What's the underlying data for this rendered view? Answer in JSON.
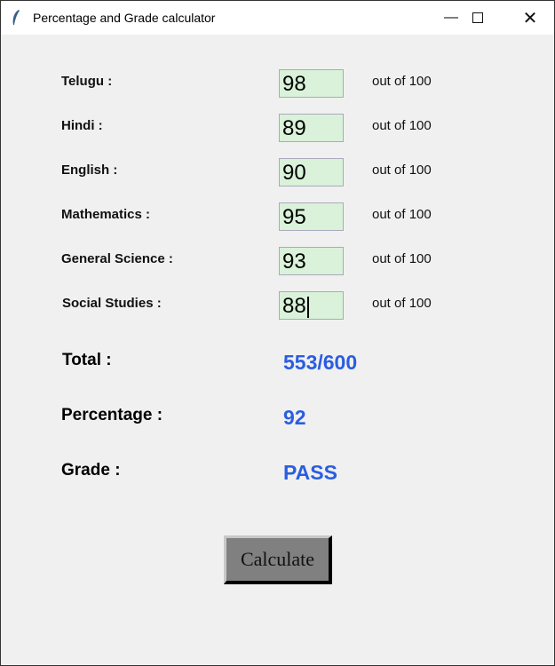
{
  "window": {
    "title": "Percentage and Grade calculator"
  },
  "subjects": [
    {
      "label": "Telugu :",
      "value": "98",
      "suffix": "out of 100"
    },
    {
      "label": "Hindi :",
      "value": "89",
      "suffix": "out of 100"
    },
    {
      "label": "English :",
      "value": "90",
      "suffix": "out of 100"
    },
    {
      "label": "Mathematics :",
      "value": "95",
      "suffix": "out of 100"
    },
    {
      "label": "General Science :",
      "value": "93",
      "suffix": "out of 100"
    },
    {
      "label": "Social Studies :",
      "value": "88",
      "suffix": "out of 100"
    }
  ],
  "results": {
    "total_label": "Total :",
    "total_value": "553/600",
    "percentage_label": "Percentage :",
    "percentage_value": "92",
    "grade_label": "Grade :",
    "grade_value": "PASS"
  },
  "button": {
    "label": "Calculate"
  },
  "colors": {
    "result": "#2a5de0",
    "entry_bg": "#d9f2d9"
  }
}
